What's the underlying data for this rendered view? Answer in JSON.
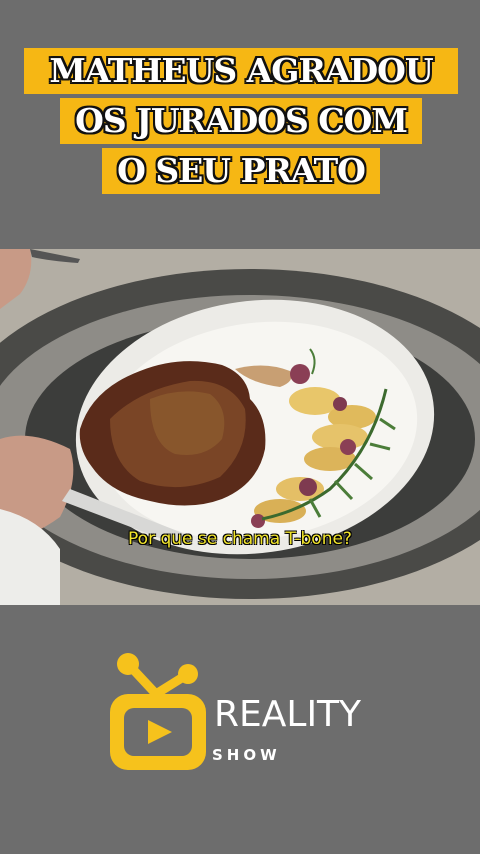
{
  "title": {
    "line1": "MATHEUS AGRADOU",
    "line2": "OS JURADOS COM",
    "line3": "O SEU PRATO"
  },
  "video": {
    "subtitle": "Por que se chama T-bone?"
  },
  "logo": {
    "brand": "REALITY",
    "tagline": "SHOW"
  },
  "colors": {
    "accent": "#f6b714",
    "background": "#6d6d6d",
    "subtitle": "#f2e52c"
  }
}
